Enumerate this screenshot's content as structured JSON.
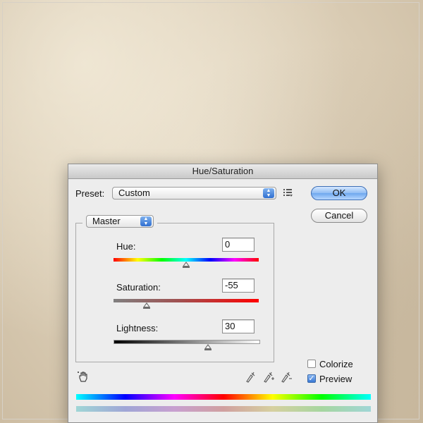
{
  "window": {
    "title": "Hue/Saturation"
  },
  "preset": {
    "label": "Preset:",
    "value": "Custom"
  },
  "buttons": {
    "ok": "OK",
    "cancel": "Cancel"
  },
  "channel": {
    "value": "Master"
  },
  "adjustments": {
    "hue": {
      "label": "Hue:",
      "value": "0"
    },
    "saturation": {
      "label": "Saturation:",
      "value": "-55"
    },
    "lightness": {
      "label": "Lightness:",
      "value": "30"
    }
  },
  "options": {
    "colorize": {
      "label": "Colorize",
      "checked": false
    },
    "preview": {
      "label": "Preview",
      "checked": true
    }
  },
  "icons": [
    "preset-options-icon",
    "hand-adjust-icon",
    "eyedropper-icon",
    "eyedropper-plus-icon",
    "eyedropper-minus-icon",
    "checkmark-icon",
    "popup-arrows-icon"
  ],
  "colors": {
    "accent": "#3a78d4"
  }
}
